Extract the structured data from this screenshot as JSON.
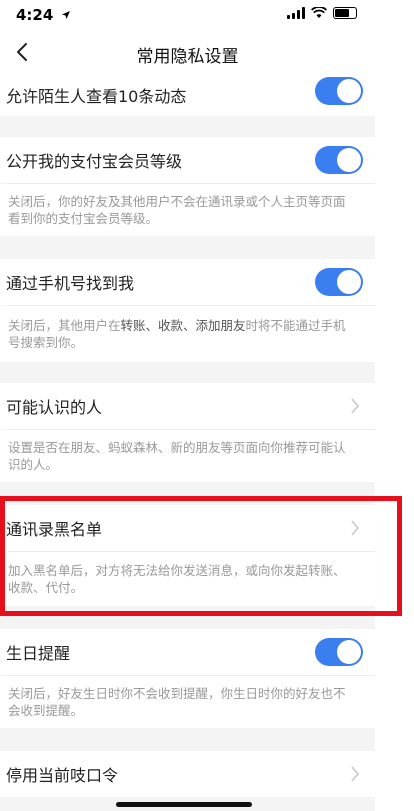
{
  "status": {
    "time": "4:24"
  },
  "nav": {
    "title": "常用隐私设置"
  },
  "items": {
    "stranger_feed": {
      "label": "允许陌生人查看10条动态"
    },
    "member_level": {
      "label": "公开我的支付宝会员等级",
      "desc": "关闭后，你的好友及其他用户不会在通讯录或个人主页等页面看到你的支付宝会员等级。"
    },
    "find_by_phone": {
      "label": "通过手机号找到我",
      "desc_part1": "关闭后，其他用户在",
      "desc_em1": "转账、收款、添加朋友",
      "desc_part2": "时将不能通过手机号搜索到你。"
    },
    "people_you_may_know": {
      "label": "可能认识的人",
      "desc": "设置是否在朋友、蚂蚁森林、新的朋友等页面向你推荐可能认识的人。"
    },
    "blacklist": {
      "label": "通讯录黑名单",
      "desc": "加入黑名单后，对方将无法给你发送消息，或向你发起转账、收款、代付。"
    },
    "birthday": {
      "label": "生日提醒",
      "desc": "关闭后，好友生日时你不会收到提醒，你生日时你的好友也不会收到提醒。"
    },
    "password": {
      "label": "停用当前吱口令"
    }
  },
  "colors": {
    "accent": "#3b7ef0",
    "highlight": "#e5101b"
  },
  "icons": [
    "back-chevron-icon",
    "chevron-right-icon",
    "wifi-icon",
    "battery-icon",
    "location-arrow-icon"
  ]
}
